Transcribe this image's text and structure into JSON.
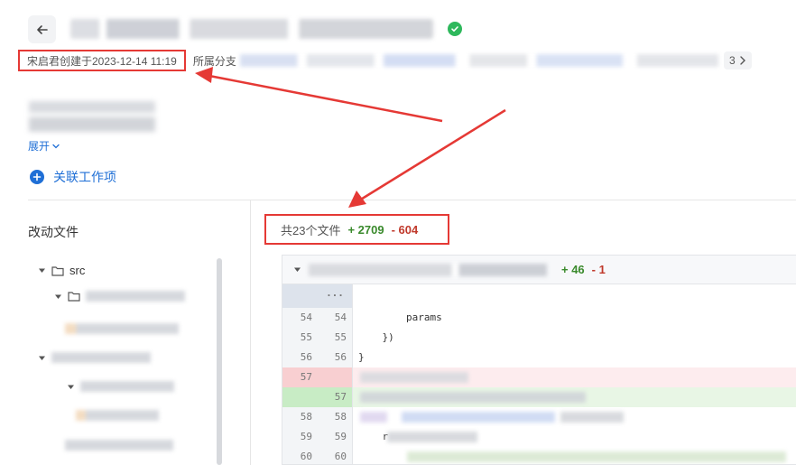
{
  "header": {
    "back_icon": "arrow-left-icon",
    "status_icon": "check-circle-icon",
    "status_color": "#2eb85c"
  },
  "meta": {
    "created": "宋启君创建于2023-12-14 11:19",
    "branch_label": "所属分支",
    "more_count": "3"
  },
  "description": {
    "expand_label": "展开"
  },
  "link_work_item": {
    "label": "关联工作项"
  },
  "file_tree": {
    "title": "改动文件",
    "root_folder": "src"
  },
  "summary": {
    "files_label": "共23个文件",
    "additions": "+ 2709",
    "deletions": "- 604"
  },
  "diff": {
    "additions": "+ 46",
    "deletions": "- 1",
    "expander": "···",
    "rows": [
      {
        "old": "54",
        "new": "54",
        "code": "        params",
        "type": "context"
      },
      {
        "old": "55",
        "new": "55",
        "code": "    })",
        "type": "context"
      },
      {
        "old": "56",
        "new": "56",
        "code": "}",
        "type": "context"
      },
      {
        "old": "57",
        "new": "",
        "code": "",
        "type": "del"
      },
      {
        "old": "",
        "new": "57",
        "code": "",
        "type": "add"
      },
      {
        "old": "58",
        "new": "58",
        "code": "",
        "type": "context"
      },
      {
        "old": "59",
        "new": "59",
        "code": "    r",
        "type": "context"
      },
      {
        "old": "60",
        "new": "60",
        "code": "",
        "type": "context"
      }
    ]
  },
  "colors": {
    "annotation_red": "#e53935",
    "link_blue": "#1f6fd6",
    "add_green": "#3a8a2c",
    "del_red": "#c0392b"
  }
}
